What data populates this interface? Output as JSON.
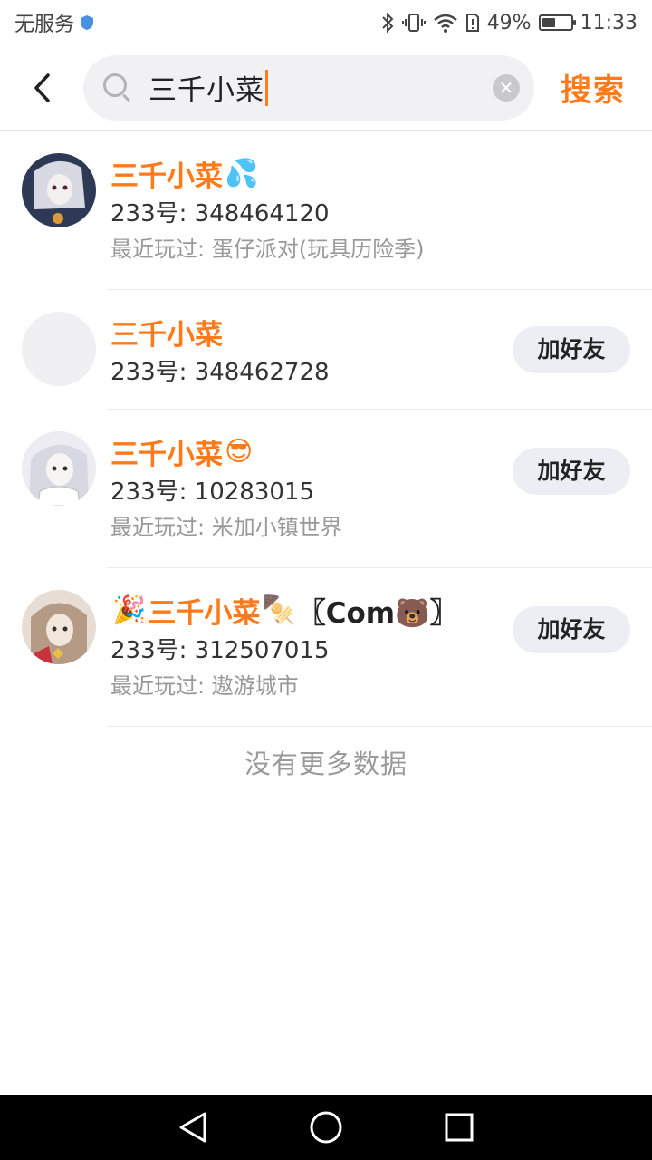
{
  "status_bar": {
    "carrier": "无服务",
    "battery_percent": "49%",
    "battery_level": 0.49,
    "time": "11:33"
  },
  "search": {
    "query": "三千小菜",
    "submit_label": "搜索"
  },
  "results": [
    {
      "name": "三千小菜",
      "name_suffix": "💦",
      "uid": "233号: 348464120",
      "recent": "最近玩过: 蛋仔派对(玩具历险季)",
      "avatar_color": "#2e3a55",
      "add_label": ""
    },
    {
      "name": "三千小菜",
      "uid": "233号: 348462728",
      "recent": "",
      "avatar_color": "#f0f0f3",
      "add_label": "加好友"
    },
    {
      "name": "三千小菜",
      "name_suffix": "😎",
      "uid": "233号: 10283015",
      "recent": "最近玩过: 米加小镇世界",
      "avatar_color": "#dcdde6",
      "add_label": "加好友"
    },
    {
      "name_prefix": "🎉",
      "name": "三千小菜",
      "name_suffix": "🍢",
      "name_tag": "〖Com🐻〗",
      "uid": "233号: 312507015",
      "recent": "最近玩过: 遨游城市",
      "avatar_color": "#b59a86",
      "add_label": "加好友"
    }
  ],
  "footer": {
    "no_more_text": "没有更多数据"
  },
  "colors": {
    "accent": "#ff7a1a"
  }
}
